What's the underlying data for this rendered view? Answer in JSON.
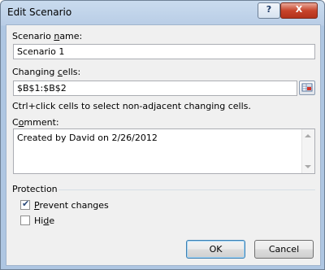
{
  "window": {
    "title": "Edit Scenario"
  },
  "titlebar": {
    "help_label": "?",
    "close_label": "X"
  },
  "scenario_name": {
    "label_pre": "Scenario ",
    "label_underlined": "n",
    "label_post": "ame:",
    "value": "Scenario 1"
  },
  "changing_cells": {
    "label_pre": "Changing ",
    "label_underlined": "c",
    "label_post": "ells:",
    "value": "$B$1:$B$2",
    "hint": "Ctrl+click cells to select non-adjacent changing cells."
  },
  "comment": {
    "label_pre": "C",
    "label_underlined": "o",
    "label_post": "mment:",
    "value": "Created by David on 2/26/2012"
  },
  "protection": {
    "heading": "Protection",
    "prevent_changes": {
      "label_underlined": "P",
      "label_post": "revent changes",
      "checked": true
    },
    "hide": {
      "label_pre": "Hi",
      "label_underlined": "d",
      "label_post": "e",
      "checked": false
    }
  },
  "buttons": {
    "ok_label": "OK",
    "cancel_label": "Cancel"
  },
  "icons": {
    "refedit": "range-select-icon",
    "scroll_up": "scroll-up-arrow-icon",
    "scroll_down": "scroll-down-arrow-icon",
    "check": "checkmark-icon"
  }
}
